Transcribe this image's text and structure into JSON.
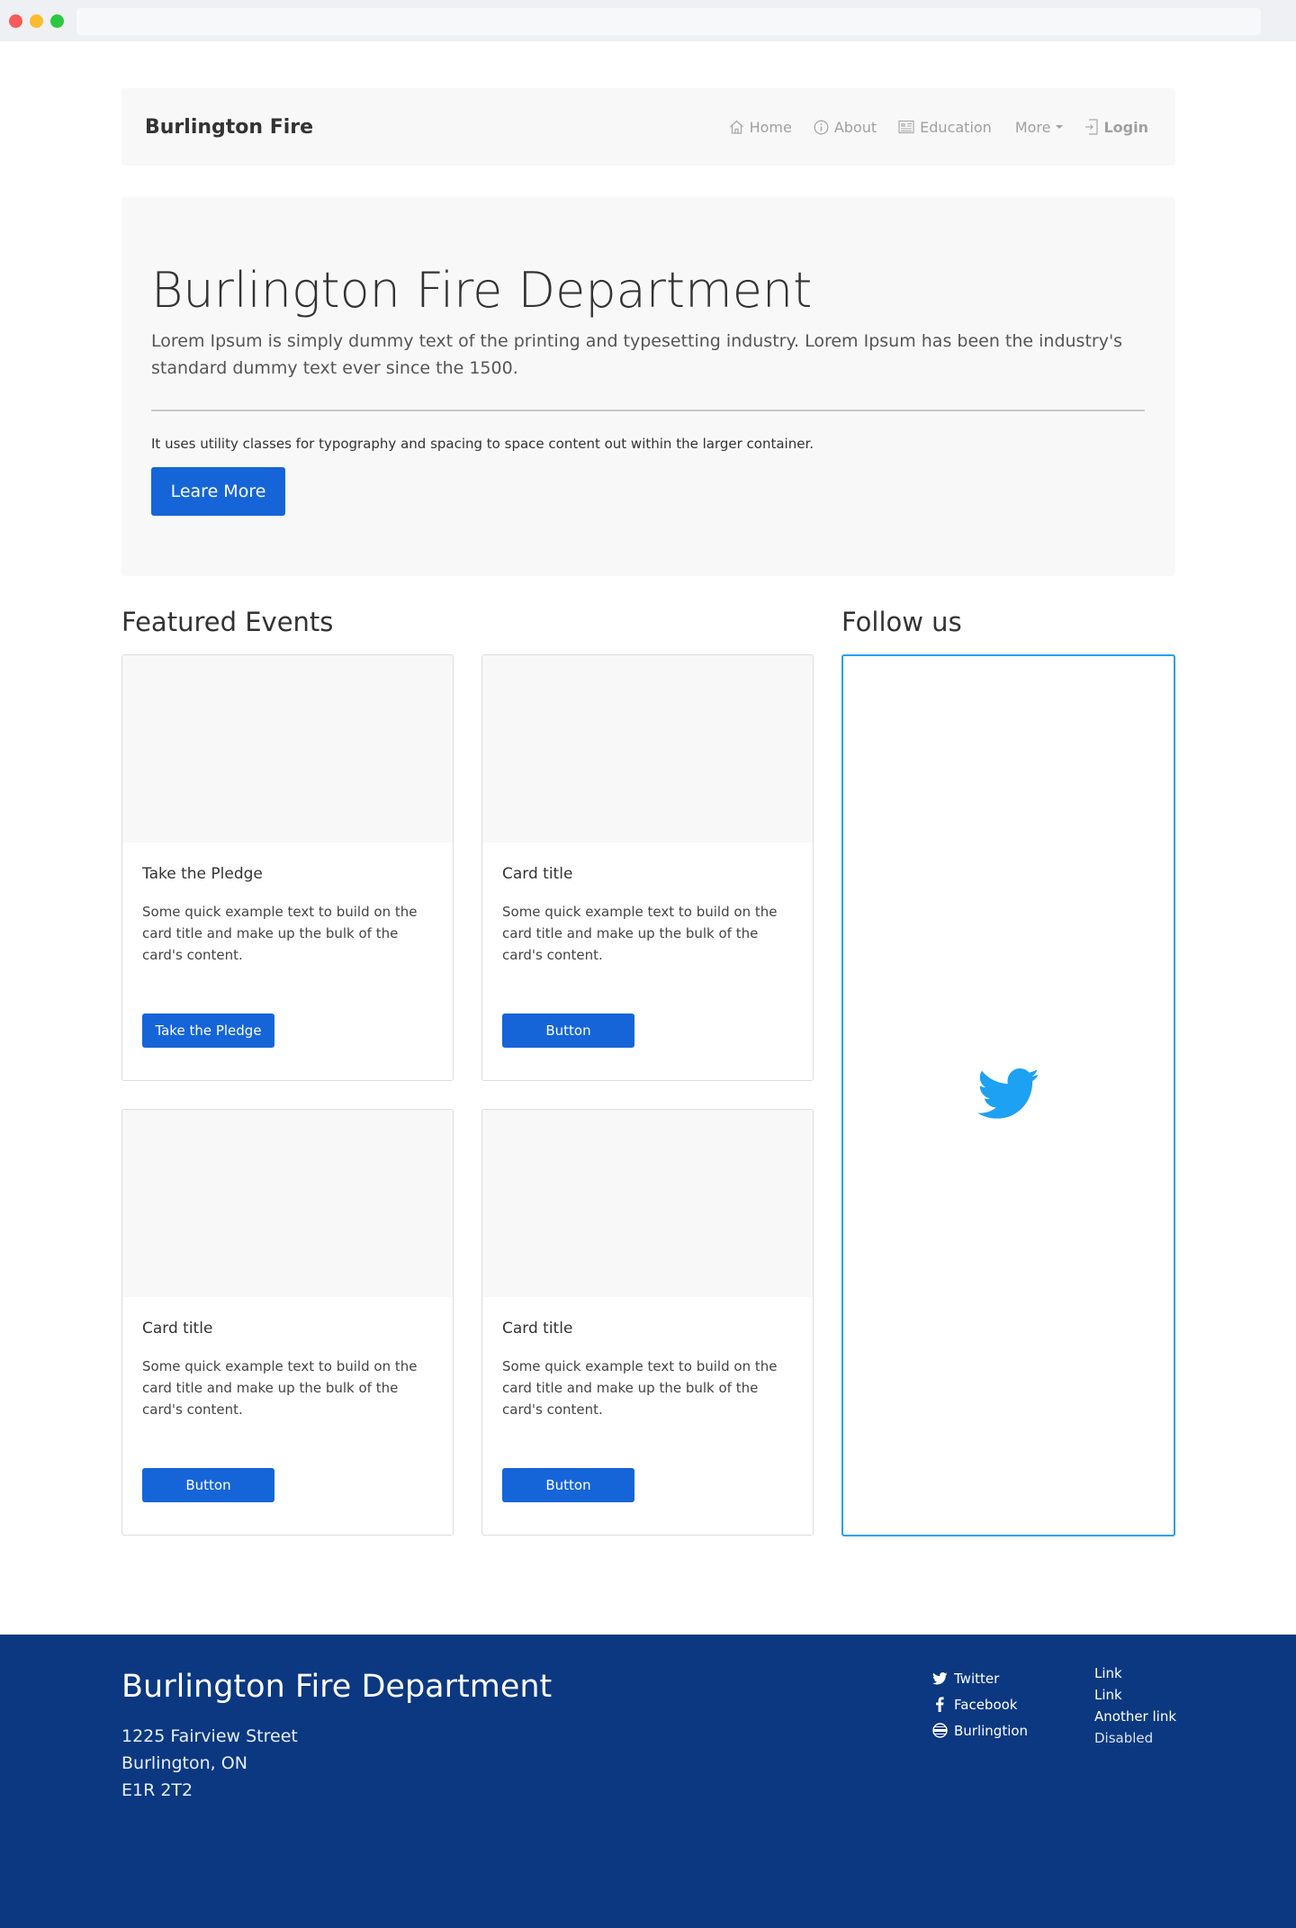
{
  "navbar": {
    "brand": "Burlington Fire",
    "items": [
      {
        "label": "Home",
        "icon": "home-icon"
      },
      {
        "label": "About",
        "icon": "info-icon"
      },
      {
        "label": "Education",
        "icon": "newspaper-icon"
      },
      {
        "label": "More",
        "icon": "caret-down-icon"
      },
      {
        "label": "Login",
        "icon": "login-icon"
      }
    ]
  },
  "jumbotron": {
    "title": "Burlington Fire Department",
    "lead": "Lorem Ipsum is simply dummy text of the printing and typesetting industry. Lorem Ipsum has been the industry's standard dummy text ever since the 1500.",
    "text": "It uses utility classes for typography and spacing to space content out within the larger container.",
    "button_label": "Leare More"
  },
  "featured": {
    "heading": "Featured Events",
    "cards": [
      {
        "title": "Take the Pledge",
        "text": "Some quick example text to build on the card title and make up the bulk of the card's content.",
        "button": "Take the Pledge"
      },
      {
        "title": "Card title",
        "text": "Some quick example text to build on the card title and make up the bulk of the card's content.",
        "button": "Button"
      },
      {
        "title": "Card title",
        "text": "Some quick example text to build on the card title and make up the bulk of the card's content.",
        "button": "Button"
      },
      {
        "title": "Card title",
        "text": "Some quick example text to build on the card title and make up the bulk of the card's content.",
        "button": "Button"
      }
    ]
  },
  "follow": {
    "heading": "Follow us",
    "icon": "twitter-bird-icon",
    "accent": "#1da1f2"
  },
  "footer": {
    "title": "Burlington Fire Department",
    "address": [
      "1225 Fairview Street",
      "Burlington, ON",
      "E1R 2T2"
    ],
    "social": [
      {
        "label": "Twitter",
        "icon": "twitter-icon"
      },
      {
        "label": "Facebook",
        "icon": "facebook-icon"
      },
      {
        "label": "Burlingtion",
        "icon": "globe-icon"
      }
    ],
    "links": [
      "Link",
      "Link",
      "Another link",
      "Disabled"
    ],
    "background": "#0b3880"
  },
  "colors": {
    "primary_button": "#1565d8",
    "panel_bg": "#f8f8f8"
  }
}
